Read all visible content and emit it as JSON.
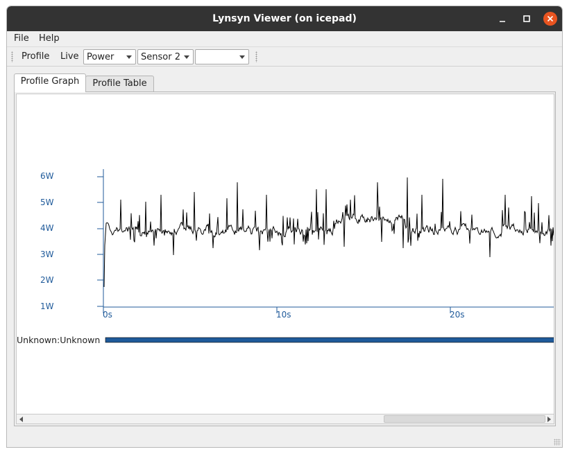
{
  "window": {
    "title": "Lynsyn Viewer (on icepad)",
    "minimize_icon": "minimize-icon",
    "maximize_icon": "maximize-icon",
    "close_icon": "close-icon",
    "close_color": "#e95420"
  },
  "menubar": {
    "file_label": "File",
    "help_label": "Help"
  },
  "toolbar": {
    "profile_label": "Profile",
    "live_label": "Live",
    "measure_combo": {
      "value": "Power"
    },
    "sensor_combo": {
      "value": "Sensor 2"
    },
    "third_combo": {
      "value": ""
    }
  },
  "tabs": [
    {
      "label": "Profile Graph",
      "active": true
    },
    {
      "label": "Profile Table",
      "active": false
    }
  ],
  "graph": {
    "y_ticks": [
      "6W",
      "5W",
      "4W",
      "3W",
      "2W",
      "1W"
    ],
    "x_ticks": [
      "0s",
      "10s",
      "20s"
    ],
    "axis_color": "#1f5a9a",
    "line_color": "#000000",
    "timeline_label": "Unknown:Unknown",
    "timeline_color": "#1f5a9a"
  },
  "scrollbar": {
    "left_arrow_icon": "scroll-left-icon",
    "right_arrow_icon": "scroll-right-icon"
  }
}
